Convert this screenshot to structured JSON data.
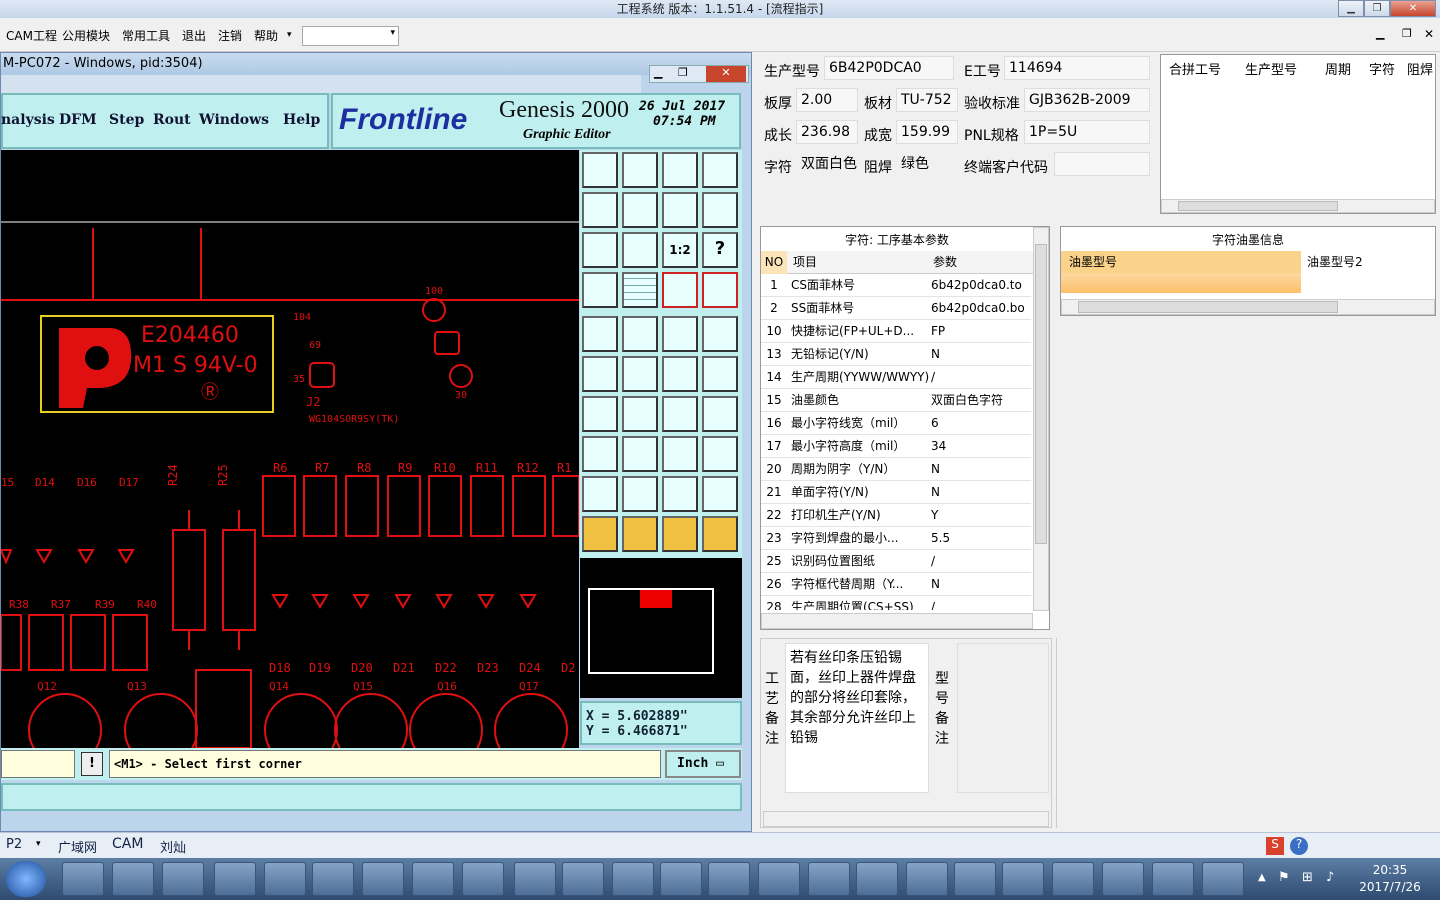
{
  "app": {
    "title": "工程系统   版本：1.1.51.4 - [流程指示]"
  },
  "menu": [
    "CAM工程",
    "公用模块",
    "常用工具",
    "退出",
    "注销",
    "帮助"
  ],
  "genesis": {
    "window_title": "M-PC072 - Windows, pid:3504)",
    "menu": [
      "nalysis",
      "DFM",
      "Step",
      "Rout",
      "Windows",
      "Help"
    ],
    "logo": "Frontline",
    "product": "Genesis 2000",
    "subtitle": "Graphic Editor",
    "date": "26 Jul 2017",
    "time": "07:54 PM",
    "coord_x": "X  =  5.602889\"",
    "coord_y": "Y  =  6.466871\"",
    "prompt": "<M1> - Select first corner",
    "unit": "Inch",
    "pcb_texts": {
      "ul": "E204460",
      "ul2": "M1  S 94V-0",
      "j2": "J2",
      "part": "WG104SOR9SY(TK)",
      "labels_top": [
        "R6",
        "R7",
        "R8",
        "R9",
        "R10",
        "R11",
        "R12",
        "R1"
      ],
      "labels_d": [
        "15",
        "D14",
        "D16",
        "D17"
      ],
      "labels_r2": [
        "R38",
        "R37",
        "R39",
        "R40"
      ],
      "labels_d2": [
        "D18",
        "D19",
        "D20",
        "D21",
        "D22",
        "D23",
        "D24",
        "D2"
      ],
      "labels_q": [
        "Q12",
        "Q13",
        "Q14",
        "Q15",
        "Q16",
        "Q17"
      ],
      "r24": "R24",
      "r25": "R25",
      "n100": "100",
      "n104": "104",
      "n69": "69",
      "n35": "35",
      "n30": "30"
    }
  },
  "info": {
    "prod_model_label": "生产型号",
    "prod_model": "6B42P0DCA0",
    "e_label": "E工号",
    "e_no": "114694",
    "thick_label": "板厚",
    "thick": "2.00",
    "mat_label": "板材",
    "mat": "TU-752",
    "std_label": "验收标准",
    "std": "GJB362B-2009",
    "len_label": "成长",
    "len": "236.98",
    "wid_label": "成宽",
    "wid": "159.99",
    "pnl_label": "PNL规格",
    "pnl": "1P=5U",
    "char_label": "字符",
    "char": "双面白色",
    "mask_label": "阻焊",
    "mask": "绿色",
    "cust_label": "终端客户代码",
    "cust": ""
  },
  "merge_grid": {
    "cols": [
      "合拼工号",
      "生产型号",
      "周期",
      "字符",
      "阻焊"
    ]
  },
  "params": {
    "title": "字符: 工序基本参数",
    "cols": [
      "NO",
      "项目",
      "参数"
    ],
    "rows": [
      [
        "1",
        "CS面菲林号",
        "6b42p0dca0.to"
      ],
      [
        "2",
        "SS面菲林号",
        "6b42p0dca0.bo"
      ],
      [
        "10",
        "快捷标记(FP+UL+D...",
        "FP"
      ],
      [
        "13",
        "无铅标记(Y/N)",
        "N"
      ],
      [
        "14",
        "生产周期(YYWW/WWYY)",
        "/"
      ],
      [
        "15",
        "油墨颜色",
        "双面白色字符"
      ],
      [
        "16",
        "最小字符线宽（mil）",
        "6"
      ],
      [
        "17",
        "最小字符高度（mil）",
        "34"
      ],
      [
        "20",
        "周期为阴字（Y/N）",
        "N"
      ],
      [
        "21",
        "单面字符(Y/N)",
        "N"
      ],
      [
        "22",
        "打印机生产(Y/N)",
        "Y"
      ],
      [
        "23",
        "字符到焊盘的最小...",
        "5.5"
      ],
      [
        "25",
        "识别码位置图纸",
        "/"
      ],
      [
        "26",
        "字符框代替周期（Y...",
        "N"
      ],
      [
        "28",
        "生产周期位置(CS+SS)",
        "/"
      ]
    ]
  },
  "ink": {
    "title": "字符油墨信息",
    "cols": [
      "油墨型号",
      "油墨型号2"
    ]
  },
  "note": {
    "left_label": [
      "工",
      "艺",
      "备",
      "注"
    ],
    "text": "若有丝印条压铅锡面，丝印上器件焊盘的部分将丝印套除，其余部分允许丝印上铅锡",
    "right_label": [
      "型",
      "号",
      "备",
      "注"
    ]
  },
  "bottom_tabs": [
    "P2",
    "广域网",
    "CAM",
    "刘灿"
  ],
  "clock": {
    "time": "20:35",
    "date": "2017/7/26"
  }
}
